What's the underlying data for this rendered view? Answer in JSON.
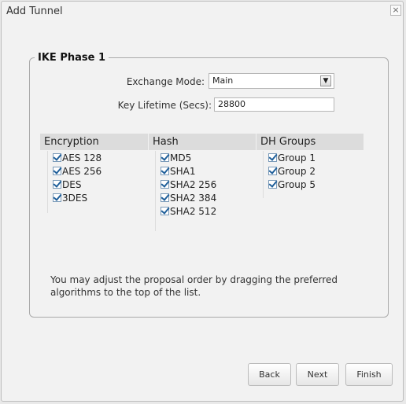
{
  "dialog": {
    "title": "Add Tunnel",
    "close": "×"
  },
  "ike": {
    "legend": "IKE Phase 1",
    "exchange_mode": {
      "label": "Exchange Mode:",
      "value": "Main"
    },
    "key_lifetime": {
      "label": "Key Lifetime (Secs):",
      "value": "28800"
    }
  },
  "columns": {
    "encryption": {
      "header": "Encryption",
      "items": [
        "AES 128",
        "AES 256",
        "DES",
        "3DES"
      ]
    },
    "hash": {
      "header": "Hash",
      "items": [
        "MD5",
        "SHA1",
        "SHA2 256",
        "SHA2 384",
        "SHA2 512"
      ]
    },
    "dh": {
      "header": "DH Groups",
      "items": [
        "Group 1",
        "Group 2",
        "Group 5"
      ]
    }
  },
  "note": "You may adjust the proposal order by dragging the preferred algorithms to the top of the list.",
  "buttons": {
    "back": "Back",
    "next": "Next",
    "finish": "Finish"
  },
  "colors": {
    "header_bg": "#dcdcdc",
    "check": "#1f5f9a"
  }
}
